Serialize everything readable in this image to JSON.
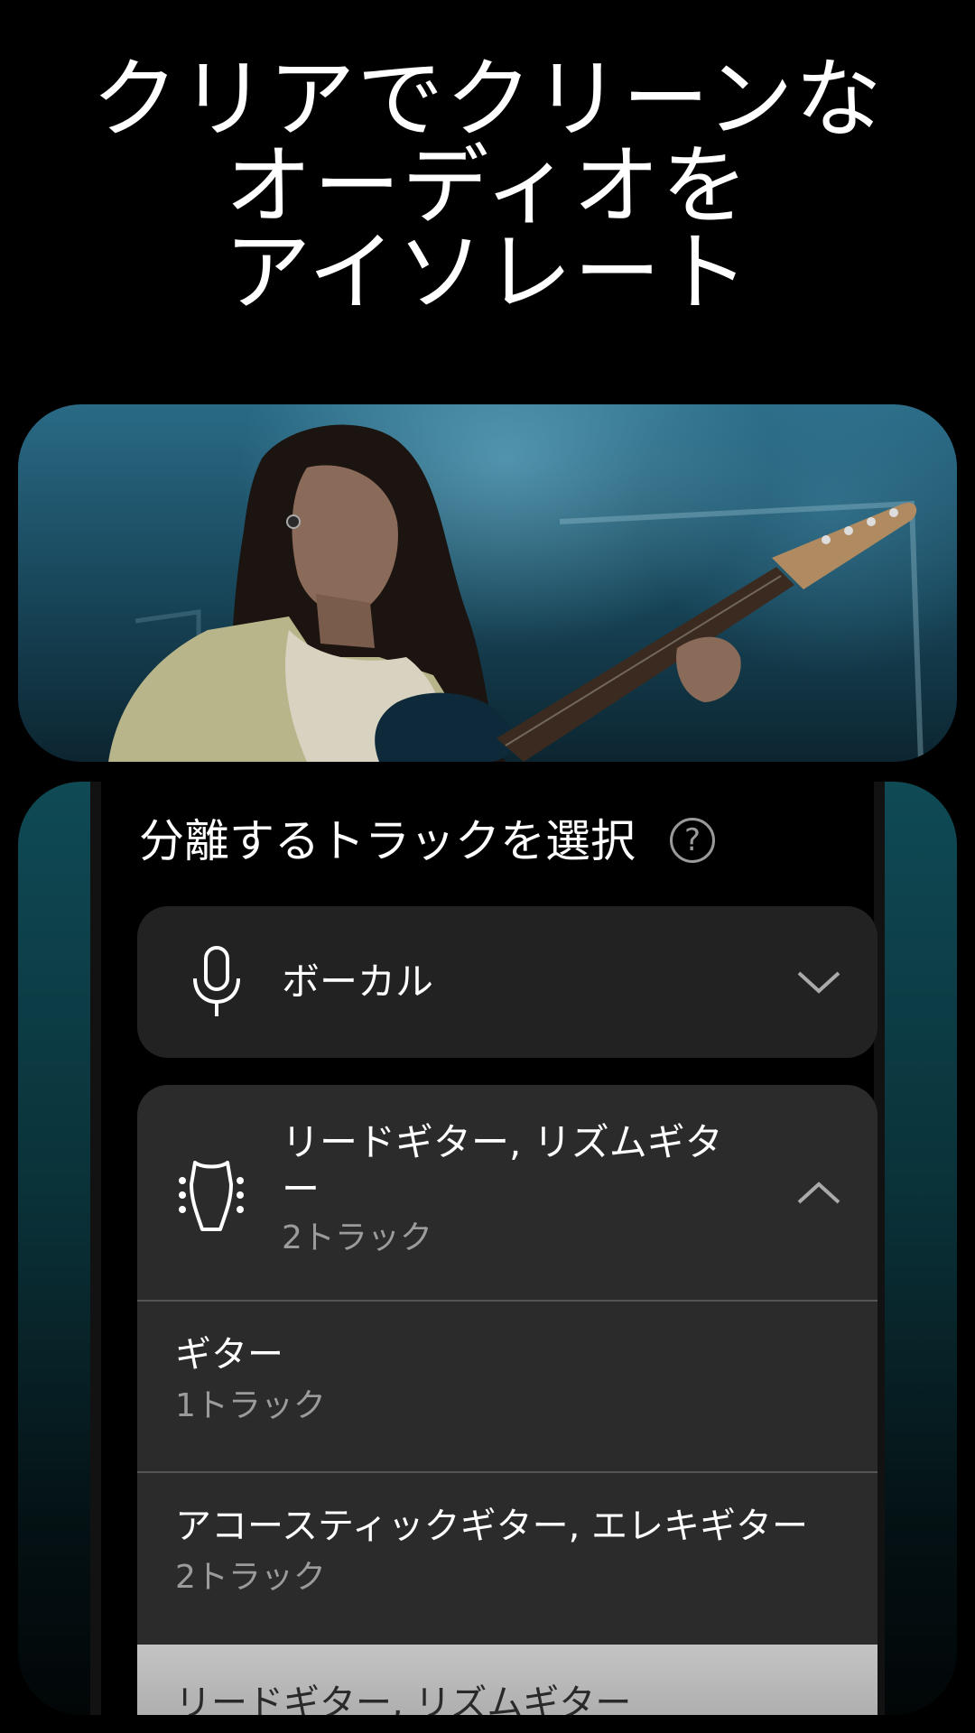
{
  "headline": {
    "line1": "クリアでクリーンな",
    "line2": "オーディオを",
    "line3": "アイソレート"
  },
  "panel": {
    "title": "分離するトラックを選択",
    "help_symbol": "?",
    "vocals": {
      "icon": "microphone-icon",
      "label": "ボーカル",
      "state": "collapsed"
    },
    "guitar": {
      "icon": "guitar-headstock-icon",
      "label_line1": "リードギター, リズムギタ",
      "label_line2": "ー",
      "count": "2トラック",
      "state": "expanded",
      "options": [
        {
          "label": "ギター",
          "count": "1トラック"
        },
        {
          "label": "アコースティックギター, エレキギター",
          "count": "2トラック"
        },
        {
          "label": "リードギター, リズムギター"
        }
      ]
    }
  },
  "colors": {
    "background": "#000000",
    "card": "#222222",
    "expanded_card": "#2b2b2b",
    "secondary_text": "#9b9b9b",
    "teal_frame": "#0f4a55"
  }
}
